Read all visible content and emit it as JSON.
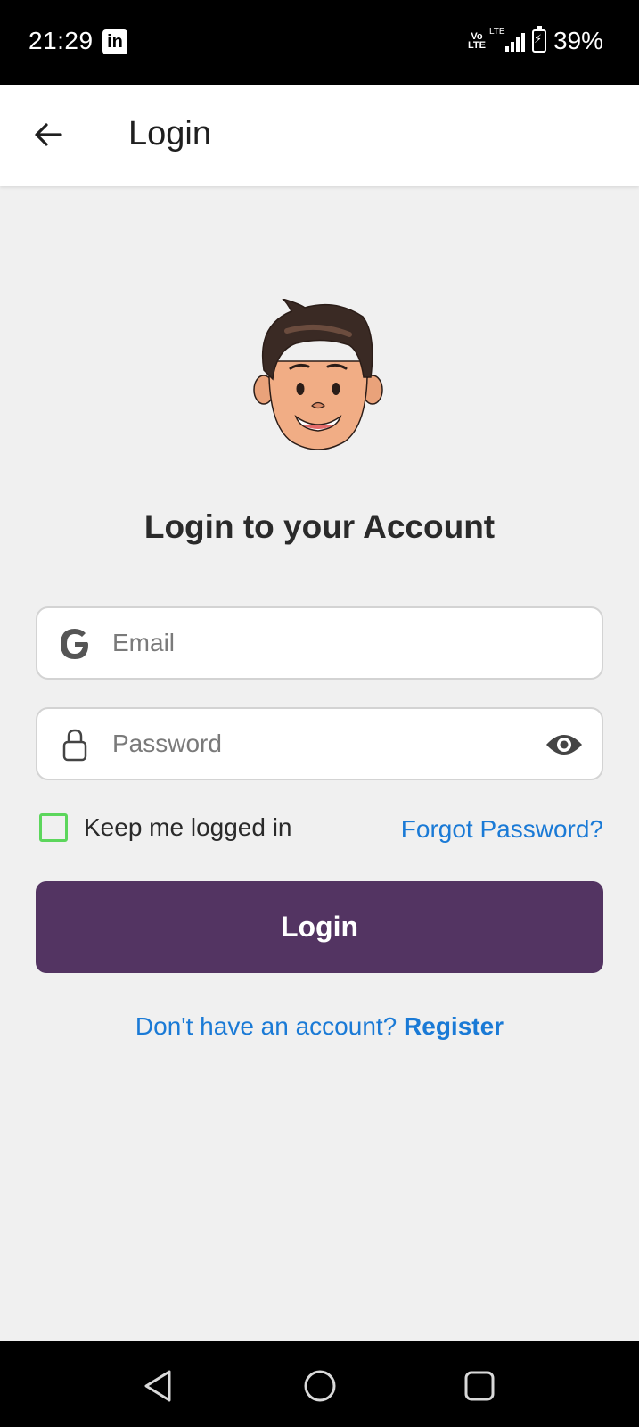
{
  "status_bar": {
    "time": "21:29",
    "app_icon": "linkedin-icon",
    "volte": "Vo LTE",
    "network": "LTE",
    "battery": "39%"
  },
  "app_bar": {
    "title": "Login",
    "back_icon": "arrow-left-icon"
  },
  "main": {
    "avatar_icon": "cartoon-boy-avatar",
    "heading": "Login to your Account",
    "email": {
      "placeholder": "Email",
      "value": "",
      "icon": "google-icon"
    },
    "password": {
      "placeholder": "Password",
      "value": "",
      "icon": "lock-icon",
      "toggle_icon": "eye-icon"
    },
    "remember_label": "Keep me logged in",
    "remember_checked": false,
    "forgot_label": "Forgot Password?",
    "login_label": "Login",
    "register_prompt": "Don't have an account?",
    "register_label": "Register"
  },
  "colors": {
    "primary": "#533462",
    "link": "#1a7ad6",
    "checkbox": "#5cd65c",
    "background": "#f0f0f0"
  },
  "nav_bar": {
    "icons": [
      "back-triangle-icon",
      "home-circle-icon",
      "recents-square-icon"
    ]
  }
}
